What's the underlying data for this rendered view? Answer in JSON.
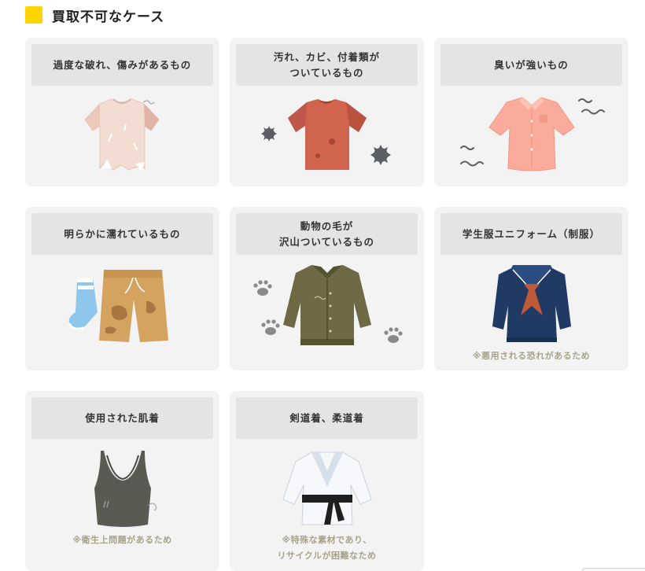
{
  "section": {
    "title": "買取不可なケース",
    "accent_color": "#ffd400"
  },
  "cards": [
    {
      "lines": [
        "過度な破れ、傷みがあるもの"
      ],
      "note": [],
      "icon": "torn-shirt-icon"
    },
    {
      "lines": [
        "汚れ、カビ、付着類が",
        "ついているもの"
      ],
      "note": [],
      "icon": "stained-shirt-icon"
    },
    {
      "lines": [
        "臭いが強いもの"
      ],
      "note": [],
      "icon": "smelly-shirt-icon"
    },
    {
      "lines": [
        "明らかに濡れているもの"
      ],
      "note": [],
      "icon": "wet-clothes-icon"
    },
    {
      "lines": [
        "動物の毛が",
        "沢山ついているもの"
      ],
      "note": [],
      "icon": "cardigan-paw-icon"
    },
    {
      "lines": [
        "学生服ユニフォーム（制服）"
      ],
      "note": [
        "※悪用される恐れがあるため"
      ],
      "icon": "school-uniform-icon"
    },
    {
      "lines": [
        "使用された肌着"
      ],
      "note": [
        "※衛生上問題があるため"
      ],
      "icon": "tank-top-icon"
    },
    {
      "lines": [
        "剣道着、柔道着"
      ],
      "note": [
        "※特殊な素材であり、",
        "リサイクルが困難なため"
      ],
      "icon": "judo-gi-icon"
    }
  ]
}
